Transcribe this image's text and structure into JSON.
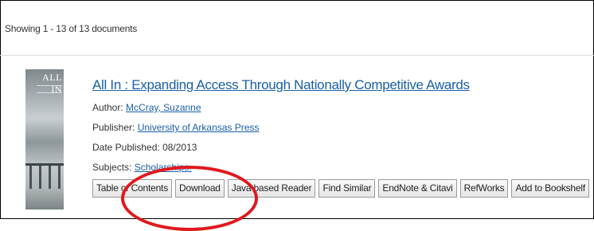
{
  "results": {
    "count_text": "Showing 1 - 13 of 13 documents"
  },
  "record": {
    "cover": {
      "title": "ALL IN"
    },
    "title": "All In : Expanding Access Through Nationally Competitive Awards",
    "author": {
      "label": "Author:",
      "value": "McCray, Suzanne"
    },
    "publisher": {
      "label": "Publisher:",
      "value": "University of Arkansas Press"
    },
    "date_published": {
      "label": "Date Published:",
      "value": "08/2013"
    },
    "subjects": {
      "label": "Subjects:",
      "value": "Scholarships."
    },
    "actions": [
      {
        "label": "Table of Contents"
      },
      {
        "label": "Download"
      },
      {
        "label": "Java based Reader"
      },
      {
        "label": "Find Similar"
      },
      {
        "label": "EndNote & Citavi"
      },
      {
        "label": "RefWorks"
      },
      {
        "label": "Add to Bookshelf"
      }
    ]
  },
  "colors": {
    "link": "#1a5fa6",
    "annotation": "#e0191e"
  }
}
